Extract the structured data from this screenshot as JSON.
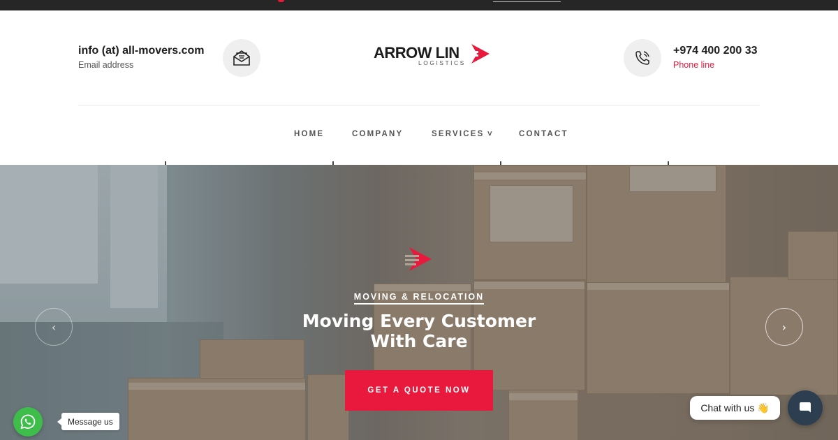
{
  "contact": {
    "email_value": "info (at) all-movers.com",
    "email_caption": "Email address",
    "phone_value": "+974 400 200 33",
    "phone_caption": "Phone line"
  },
  "logo": {
    "name": "ARROW LIN",
    "tagline": "LOGISTICS"
  },
  "nav": {
    "items": [
      {
        "label": "HOME"
      },
      {
        "label": "COMPANY"
      },
      {
        "label": "SERVICES"
      },
      {
        "label": "CONTACT"
      }
    ],
    "services_indicator": "˅"
  },
  "hero": {
    "kicker": "MOVING & RELOCATION",
    "headline_line1": "Moving Every Customer",
    "headline_line2": "With Care",
    "cta_label": "GET A QUOTE NOW",
    "prev_glyph": "‹",
    "next_glyph": "›"
  },
  "widgets": {
    "whatsapp_label": "Message us",
    "chat_label": "Chat with us 👋"
  },
  "colors": {
    "accent": "#e8193c",
    "topbar": "#262626",
    "whatsapp": "#3ebd4a",
    "chat": "#2d3e50"
  },
  "icons": {
    "email": "envelope-open-icon",
    "phone": "phone-ring-icon",
    "whatsapp": "whatsapp-icon",
    "chat": "chat-bubble-icon",
    "brand": "arrow-speed-icon"
  }
}
